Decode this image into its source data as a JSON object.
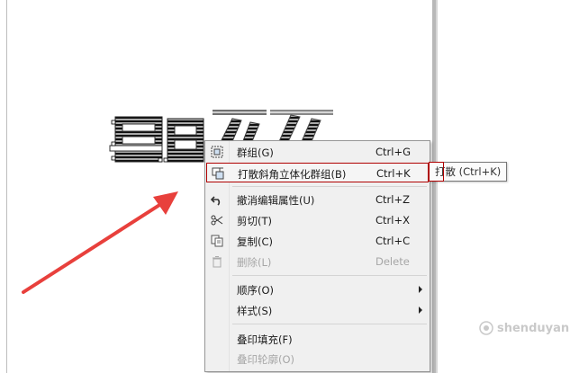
{
  "menu": {
    "items": [
      {
        "label": "群组(G)",
        "shortcut": "Ctrl+G",
        "icon": "group-icon"
      },
      {
        "label": "打散斜角立体化群组(B)",
        "shortcut": "Ctrl+K",
        "icon": "break-apart-icon"
      },
      {
        "label": "撤消编辑属性(U)",
        "shortcut": "Ctrl+Z",
        "icon": "undo-icon"
      },
      {
        "label": "剪切(T)",
        "shortcut": "Ctrl+X",
        "icon": "scissors-icon"
      },
      {
        "label": "复制(C)",
        "shortcut": "Ctrl+C",
        "icon": "copy-icon"
      },
      {
        "label": "删除(L)",
        "shortcut": "Delete",
        "icon": "trash-icon"
      },
      {
        "label": "顺序(O)"
      },
      {
        "label": "样式(S)"
      },
      {
        "label": "叠印填充(F)"
      },
      {
        "label": "叠印轮廓(O)"
      }
    ]
  },
  "tooltip": {
    "text": "打散 (Ctrl+K)"
  },
  "watermark": {
    "text": "shenduyan"
  },
  "colors": {
    "arrow": "#e8403c",
    "highlight_border": "#b00000",
    "menu_bg": "#f0f0f0"
  }
}
